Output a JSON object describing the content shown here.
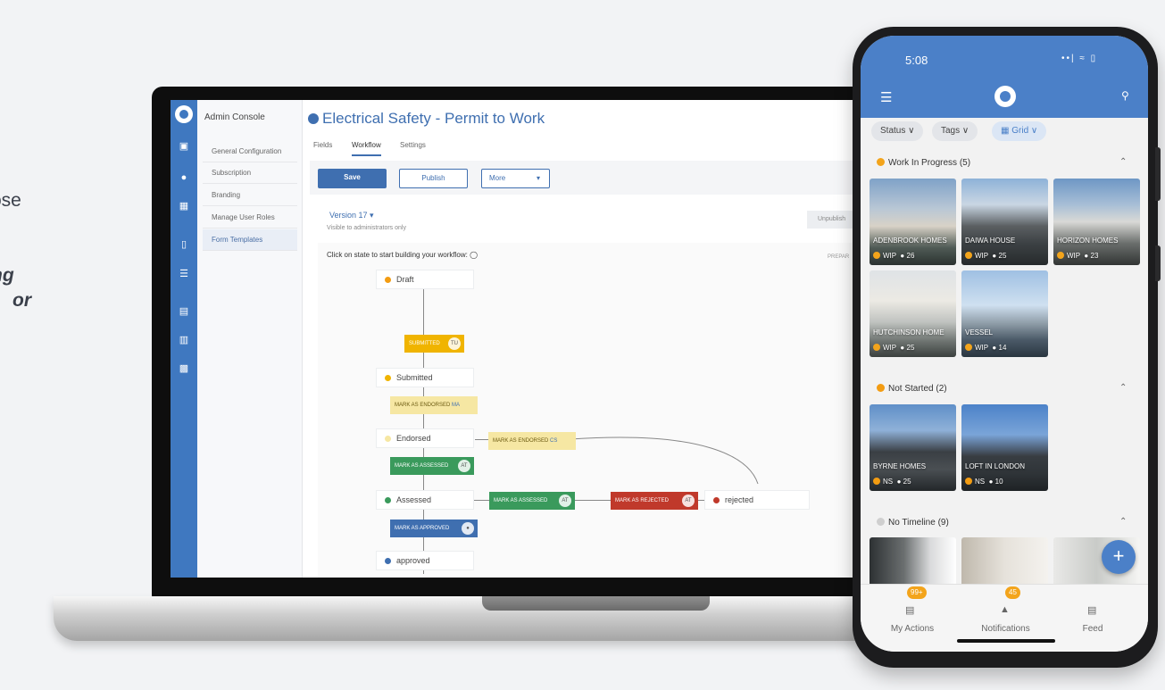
{
  "page_text": {
    "line1": "ose",
    "line2": "ng",
    "line3": "or"
  },
  "console": {
    "app_title": "Admin Console",
    "nav": [
      "General Configuration",
      "Subscription",
      "Branding",
      "Manage User Roles",
      "Form Templates"
    ],
    "page_title": "Electrical Safety - Permit to Work",
    "tabs": [
      "Fields",
      "Workflow",
      "Settings"
    ],
    "save_label": "Save",
    "publish_label": "Publish",
    "more_label": "More",
    "version_label": "Version 17 ▾",
    "visible_note": "Visible to administrators only",
    "unpublish_label": "Unpublish",
    "hint": "Click on state to start building your workflow:",
    "prepare_label": "PREPAR",
    "states": {
      "draft": "Draft",
      "submitted": "Submitted",
      "endorsed": "Endorsed",
      "assessed": "Assessed",
      "approved": "approved",
      "rejected": "rejected"
    },
    "transitions": {
      "submitted": "SUBMITTED",
      "submitted_av": "TU",
      "endorse1": "MARK AS ENDORSED",
      "endorse1_av": "MA",
      "endorse2": "MARK AS ENDORSED",
      "endorse2_av": "CS",
      "assess1": "MARK AS ASSESSED",
      "assess1_av": "AT",
      "assess2": "MARK AS ASSESSED",
      "assess2_av": "AT",
      "reject": "MARK AS REJECTED",
      "reject_av": "AT",
      "approve": "MARK AS APPROVED"
    }
  },
  "phone": {
    "time": "5:08",
    "status_icons": "••| ≈ ▯",
    "filters": {
      "status": "Status ∨",
      "tags": "Tags ∨",
      "grid": "Grid ∨"
    },
    "sections": [
      {
        "title": "Work In Progress",
        "count": "(5)"
      },
      {
        "title": "Not Started",
        "count": "(2)"
      },
      {
        "title": "No Timeline",
        "count": "(9)"
      }
    ],
    "wip_cards": [
      {
        "name": "ADENBROOK HOMES",
        "status": "WIP",
        "count": "26"
      },
      {
        "name": "DAIWA HOUSE",
        "status": "WIP",
        "count": "25"
      },
      {
        "name": "HORIZON HOMES",
        "status": "WIP",
        "count": "23"
      },
      {
        "name": "HUTCHINSON HOME",
        "status": "WIP",
        "count": "25"
      },
      {
        "name": "VESSEL",
        "status": "WIP",
        "count": "14"
      }
    ],
    "ns_cards": [
      {
        "name": "BYRNE HOMES",
        "status": "NS",
        "count": "25"
      },
      {
        "name": "LOFT IN LONDON",
        "status": "NS",
        "count": "10"
      }
    ],
    "fab": "+",
    "bottom_nav": [
      {
        "label": "My Actions",
        "badge": "99+"
      },
      {
        "label": "Notifications",
        "badge": "45"
      },
      {
        "label": "Feed",
        "badge": ""
      }
    ]
  },
  "colors": {
    "brand_blue": "#3f78c0",
    "wip_orange": "#f3a41b",
    "assessed_green": "#3a9a5c",
    "rejected_red": "#c0392b",
    "endorsed_yellow": "#f6e7a3",
    "submitted_gold": "#f0b400"
  }
}
